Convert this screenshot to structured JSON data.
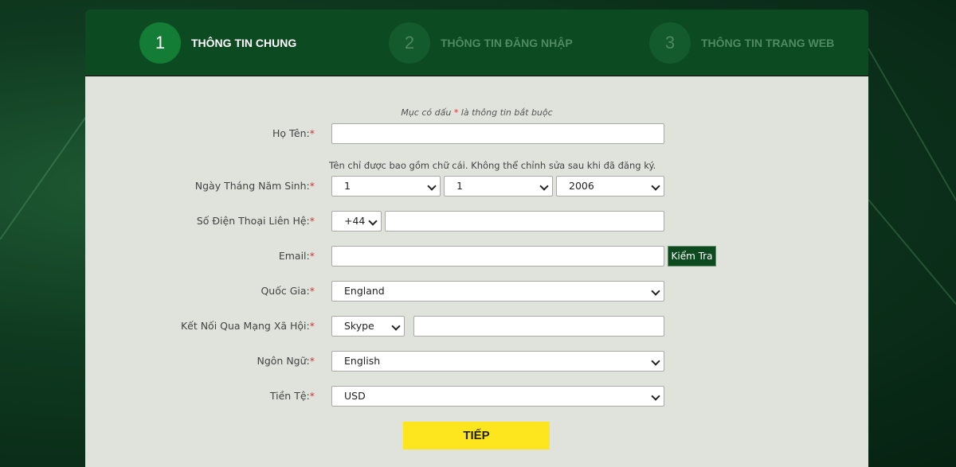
{
  "steps": [
    {
      "number": "1",
      "label": "THÔNG TIN CHUNG",
      "active": true
    },
    {
      "number": "2",
      "label": "THÔNG TIN ĐĂNG NHẬP",
      "active": false
    },
    {
      "number": "3",
      "label": "THÔNG TIN TRANG WEB",
      "active": false
    }
  ],
  "form": {
    "required_note_prefix": "Mục có dấu ",
    "required_mark": "*",
    "required_note_suffix": " là thông tin bắt buộc",
    "fullname": {
      "label": "Họ Tên:",
      "value": ""
    },
    "name_hint": "Tên chỉ được bao gồm chữ cái. Không thể chỉnh sửa sau khi đã đăng ký.",
    "dob": {
      "label": "Ngày Tháng Năm Sinh:",
      "day": "1",
      "month": "1",
      "year": "2006"
    },
    "phone": {
      "label": "Số Điện Thoại Liên Hệ:",
      "code": "+44",
      "value": ""
    },
    "email": {
      "label": "Email:",
      "value": "",
      "check_button": "Kiểm Tra"
    },
    "country": {
      "label": "Quốc Gia:",
      "value": "England"
    },
    "social": {
      "label": "Kết Nối Qua Mạng Xã Hội:",
      "type": "Skype",
      "value": ""
    },
    "language": {
      "label": "Ngôn Ngữ:",
      "value": "English"
    },
    "currency": {
      "label": "Tiền Tệ:",
      "value": "USD"
    },
    "next_button": "TIẾP"
  },
  "colors": {
    "header": "#0c4a22",
    "accent": "#137c35",
    "button_yellow": "#fde61e",
    "required_red": "#e0312f"
  }
}
